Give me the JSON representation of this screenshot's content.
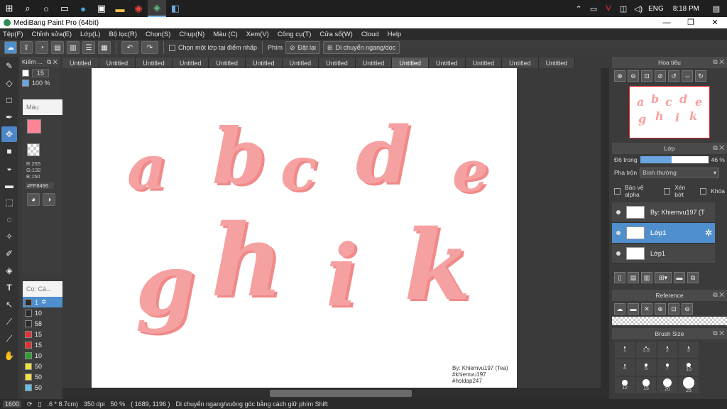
{
  "taskbar": {
    "icons": [
      "windows-start",
      "search",
      "cortana",
      "task-view",
      "edge",
      "store",
      "file-explorer",
      "chrome",
      "medibang",
      "paint-app"
    ],
    "tray": {
      "language": "ENG",
      "time": "8:18 PM"
    }
  },
  "window": {
    "title": "MediBang Paint Pro (64bit)",
    "min": "—",
    "max": "❐",
    "close": "✕"
  },
  "menu": [
    "Tệp(F)",
    "Chỉnh sửa(E)",
    "Lớp(L)",
    "Bộ lọc(R)",
    "Chọn(S)",
    "Chụp(N)",
    "Màu (C)",
    "Xem(V)",
    "Công cụ(T)",
    "Cửa sổ(W)",
    "Cloud",
    "Help"
  ],
  "toolbar": {
    "select_layer_label": "Chọn một lớp tại điểm nhấp",
    "shortcut_label": "Phím",
    "reset_label": "Đặt lại",
    "move_label": "Di chuyển ngang/dọc"
  },
  "brush_panel": {
    "title": "Kiểm ...",
    "size": "15",
    "opacity": "100 %"
  },
  "color_panel": {
    "title": "Màu",
    "r": "R:255",
    "g": "G:132",
    "b": "B:150",
    "hex": "#FF8496",
    "fg_color": "#ff8496",
    "bg_color": "#ff3b6a"
  },
  "size_panel": {
    "title": "Cọ: Cá...",
    "items": [
      {
        "size": "1",
        "color": "#2d2d2d"
      },
      {
        "size": "10",
        "color": "#2d2d2d"
      },
      {
        "size": "58",
        "color": "#2d2d2d"
      },
      {
        "size": "15",
        "color": "#e03030"
      },
      {
        "size": "15",
        "color": "#e03030"
      },
      {
        "size": "10",
        "color": "#2ca02c"
      },
      {
        "size": "50",
        "color": "#f0e040"
      },
      {
        "size": "50",
        "color": "#f0e040"
      },
      {
        "size": "50",
        "color": "#60c0e8"
      }
    ]
  },
  "tabs": [
    "Untitled",
    "Untitled",
    "Untitled",
    "Untitled",
    "Untitled",
    "Untitled",
    "Untitled",
    "Untitled",
    "Untitled",
    "Untitled",
    "Untitled",
    "Untitled",
    "Untitled",
    "Untitled"
  ],
  "active_tab": 9,
  "canvas": {
    "row1": [
      "a",
      "b",
      "c",
      "d",
      "e"
    ],
    "row2": [
      "g",
      "h",
      "i",
      "k"
    ],
    "credit": [
      "By: Khiemvu197 (Tea)",
      "#khiemvu197",
      "#holdap247"
    ]
  },
  "status": {
    "size": ".6 * 8.7cm)",
    "dpi": "350 dpi",
    "zoom": "50 %",
    "coords": "( 1689, 1196 )",
    "hint": "Di chuyển ngang/vuông góc bằng cách giữ phím Shift",
    "zoom_field": "1600"
  },
  "navigator": {
    "title": "Hoa tiêu"
  },
  "layer_panel": {
    "title": "Lớp",
    "opacity_label": "Độ trong",
    "opacity_value": "46 %",
    "opacity_fraction": 0.46,
    "blend_label": "Pha trộn",
    "blend_value": "Bình thường",
    "protect_alpha": "Bảo vệ alpha",
    "clip": "Xén bớt",
    "lock": "Khóa",
    "layers": [
      {
        "name": "By: Khiemvu197 (T",
        "selected": false
      },
      {
        "name": "Lớp1",
        "selected": true
      },
      {
        "name": "Lớp1",
        "selected": false
      }
    ]
  },
  "reference_panel": {
    "title": "Reference"
  },
  "brush_size_panel": {
    "title": "Brush Size",
    "sizes": [
      "1",
      "1.5",
      "2",
      "3",
      "4",
      "5",
      "7",
      "10",
      "12",
      "15",
      "20",
      "25"
    ]
  }
}
